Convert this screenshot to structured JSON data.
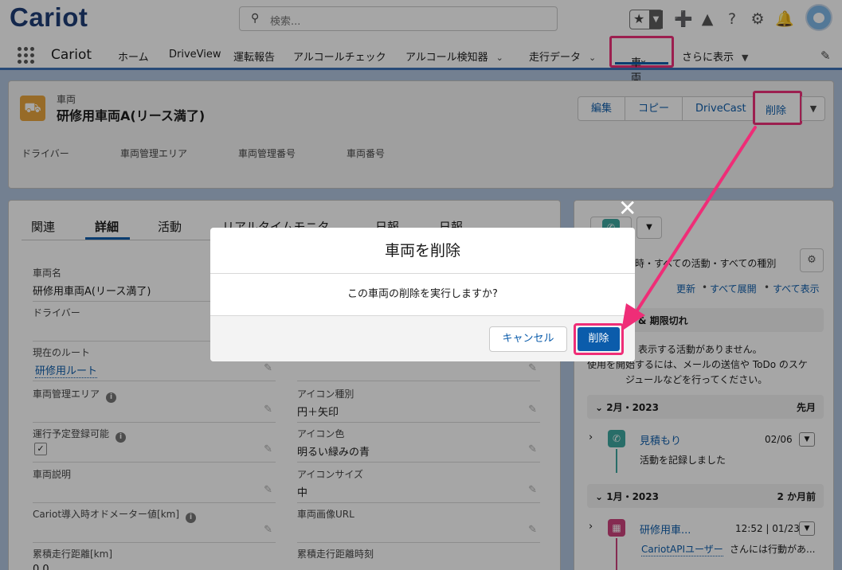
{
  "header": {
    "logo": "Cariot",
    "search_placeholder": "検索...",
    "icons": [
      "star-icon",
      "add-icon",
      "trailhead-icon",
      "help-icon",
      "gear-icon",
      "bell-icon",
      "avatar"
    ]
  },
  "nav": {
    "app_name": "Cariot",
    "items": [
      {
        "label": "ホーム",
        "dropdown": false
      },
      {
        "label": "DriveView",
        "dropdown": false
      },
      {
        "label": "運転報告",
        "dropdown": false
      },
      {
        "label": "アルコールチェック",
        "dropdown": false
      },
      {
        "label": "アルコール検知器",
        "dropdown": true
      },
      {
        "label": "走行データ",
        "dropdown": true
      },
      {
        "label": "車両",
        "dropdown": true,
        "active": true
      },
      {
        "label": "さらに表示",
        "dropdown": true
      }
    ]
  },
  "record": {
    "object_type": "車両",
    "title": "研修用車両A(リース満了)",
    "actions": [
      "編集",
      "コピー",
      "DriveCast",
      "削除"
    ],
    "highlight_fields": [
      "ドライバー",
      "車両管理エリア",
      "車両管理番号",
      "車両番号"
    ]
  },
  "detail": {
    "tabs": [
      "関連",
      "詳細",
      "活動",
      "リアルタイムモニタ",
      "日報",
      "日報"
    ],
    "active_tab": "詳細",
    "left_fields": [
      {
        "label": "車両名",
        "value": "研修用車両A(リース満了)"
      },
      {
        "label": "ドライバー",
        "value": ""
      },
      {
        "label": "現在のルート",
        "value": "研修用ルート"
      },
      {
        "label": "車両管理エリア",
        "value": ""
      },
      {
        "label": "運行予定登録可能",
        "value": "✓"
      },
      {
        "label": "車両説明",
        "value": ""
      },
      {
        "label": "Cariot導入時オドメーター値[km]",
        "value": ""
      },
      {
        "label": "累積走行距離[km]",
        "value": "0.0"
      }
    ],
    "right_fields": [
      {
        "label": "アイコン種別",
        "value": "円＋矢印"
      },
      {
        "label": "アイコン色",
        "value": "明るい緑みの青"
      },
      {
        "label": "アイコンサイズ",
        "value": "中"
      },
      {
        "label": "車両画像URL",
        "value": ""
      },
      {
        "label": "累積走行距離時刻",
        "value": ""
      }
    ]
  },
  "activity": {
    "filter_text": "時・すべての活動・すべての種別",
    "links": [
      "更新",
      "すべて展開",
      "すべて表示"
    ],
    "upcoming_title": "& 期限切れ",
    "empty_text_1": "表示する活動がありません。",
    "empty_text_2": "使用を開始するには、メールの送信や ToDo のスケ",
    "empty_text_3": "ジュールなどを行ってください。",
    "groups": [
      {
        "period": "2月・2023",
        "relative": "先月",
        "item_title": "見積もり",
        "item_date": "02/06",
        "item_desc": "活動を記録しました"
      },
      {
        "period": "1月・2023",
        "relative": "2 か月前",
        "item_title": "研修用車...",
        "item_date": "12:52 | 01/23",
        "item_user": "CariotAPIユーザー",
        "item_desc": "さんには行動があ..."
      }
    ]
  },
  "modal": {
    "title": "車両を削除",
    "message": "この車両の削除を実行しますか?",
    "cancel_label": "キャンセル",
    "confirm_label": "削除"
  },
  "colors": {
    "brand": "#0b5cab",
    "highlight": "#ef2d77",
    "record_icon": "#e8a33a"
  }
}
